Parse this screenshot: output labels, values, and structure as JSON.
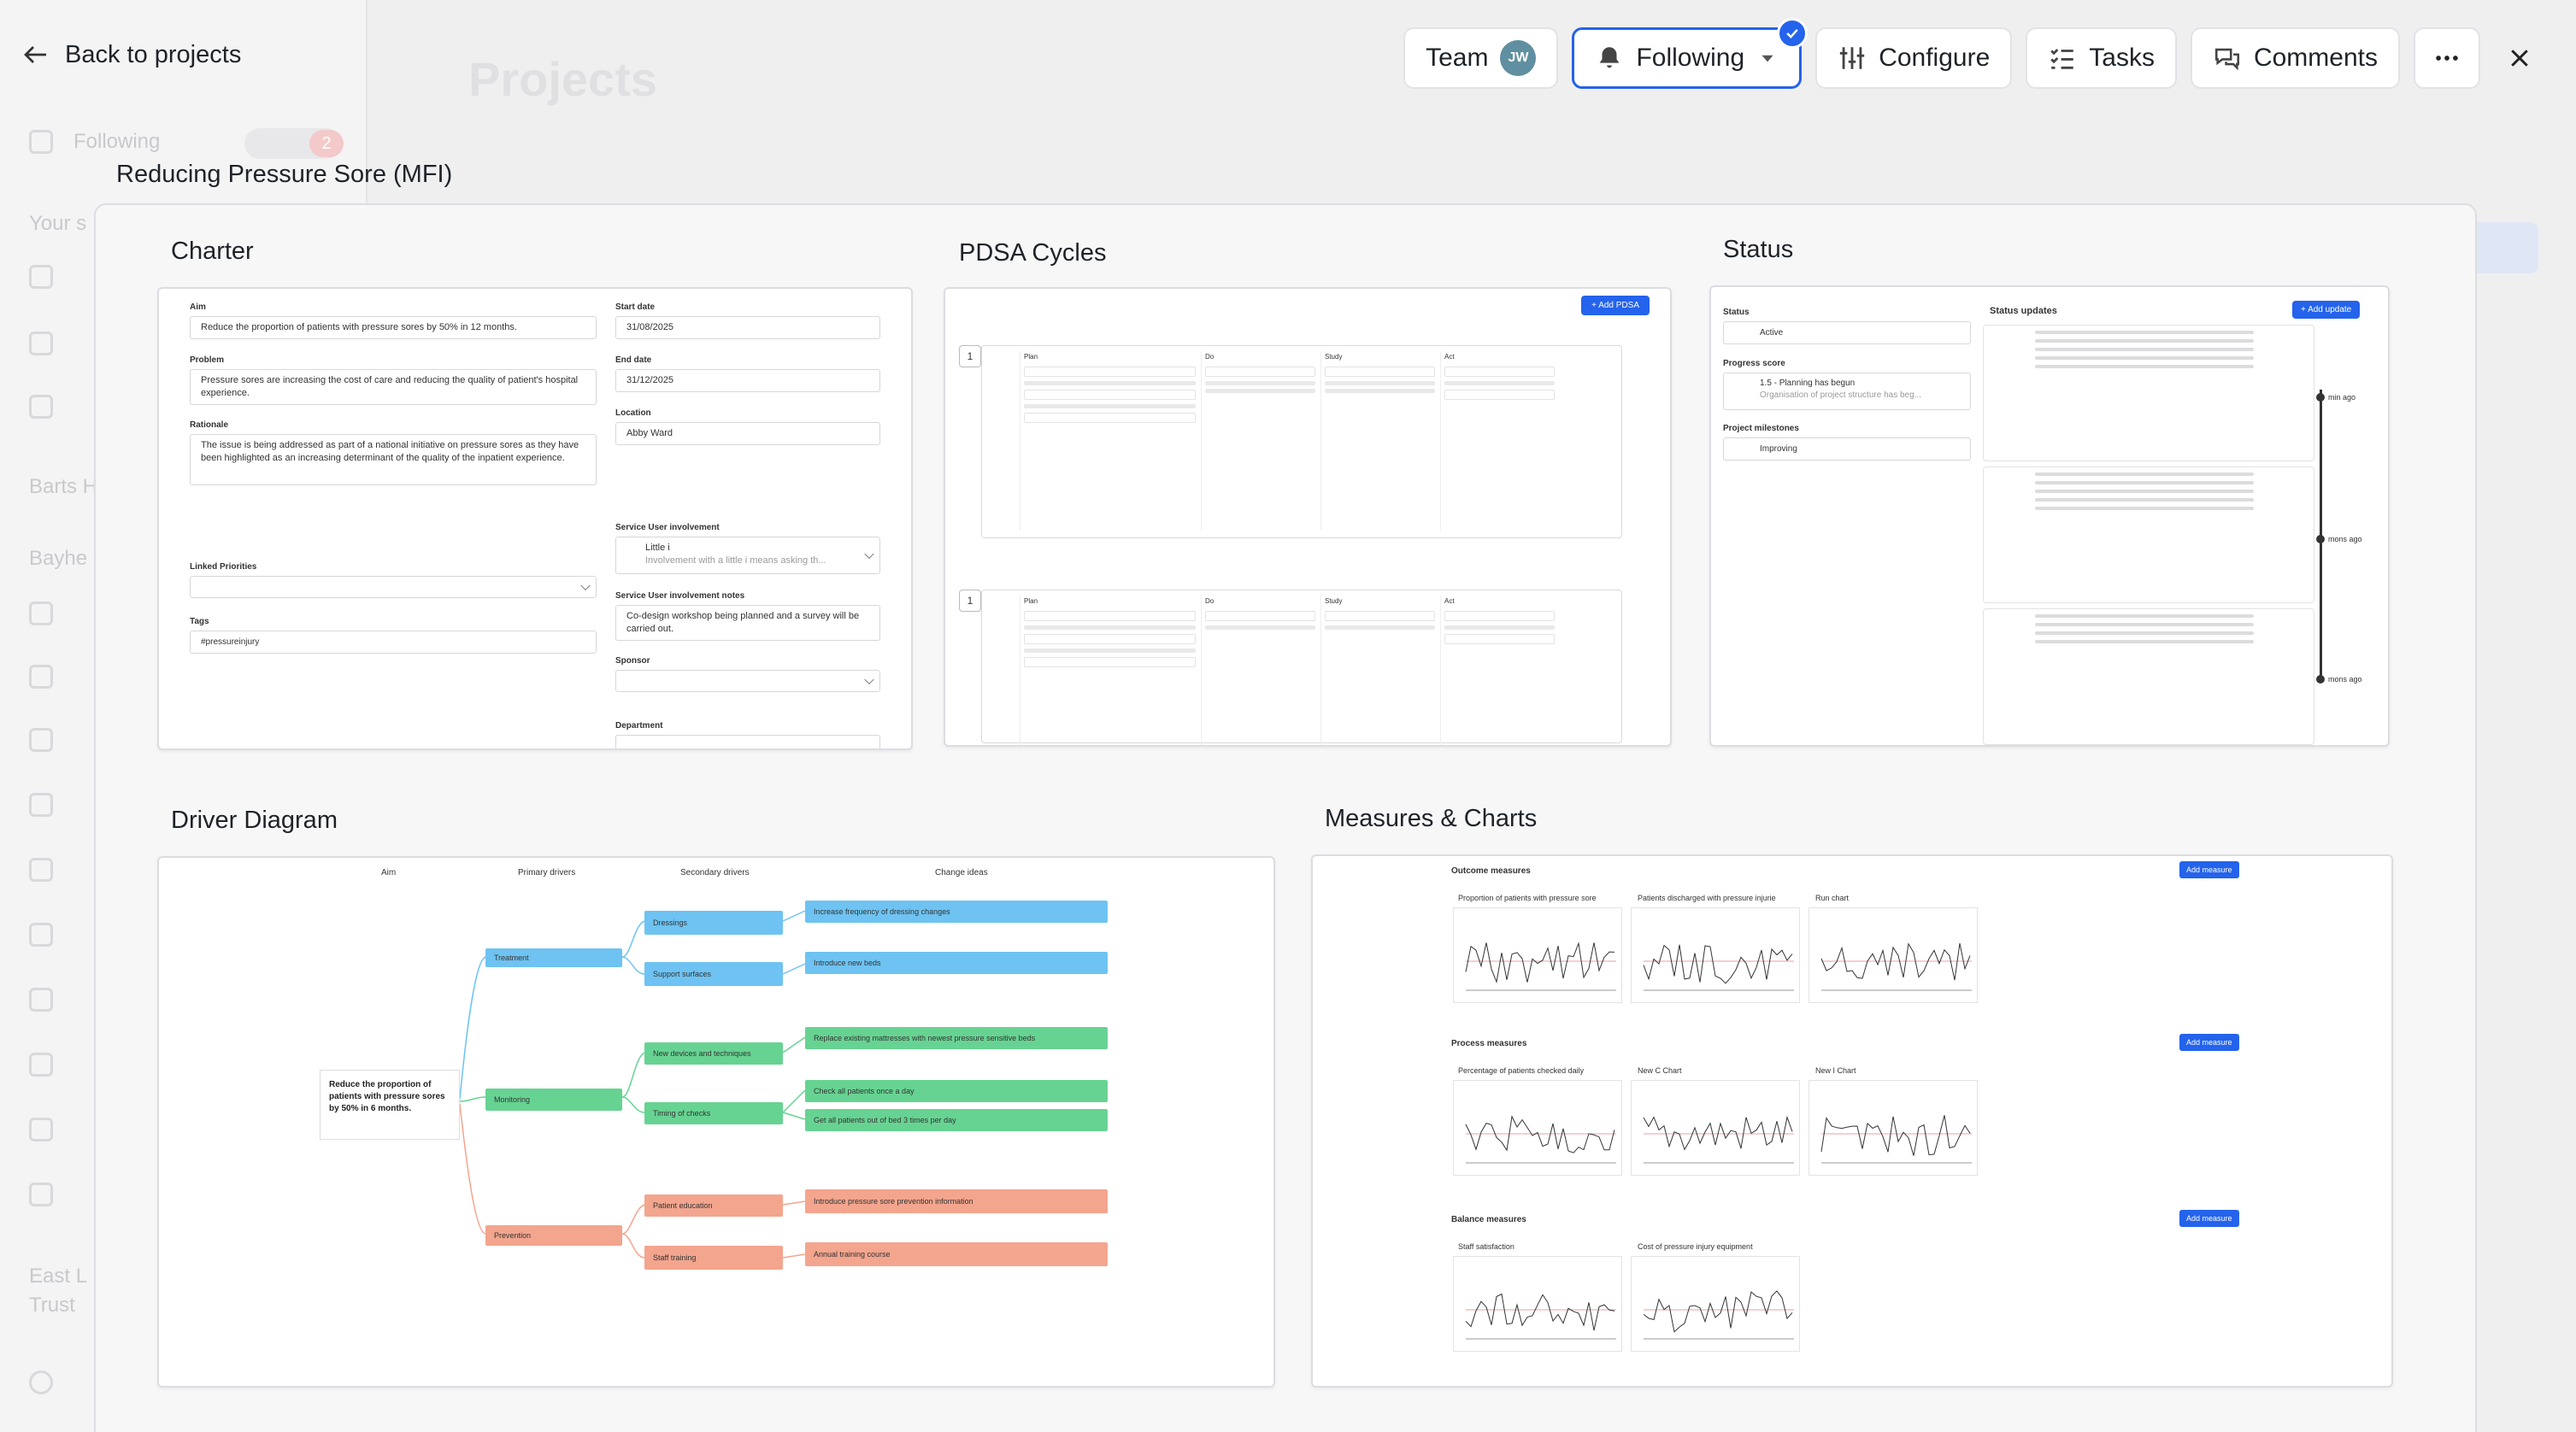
{
  "header": {
    "back_label": "Back to projects",
    "team_label": "Team",
    "team_avatar": "JW",
    "following_label": "Following",
    "configure_label": "Configure",
    "tasks_label": "Tasks",
    "comments_label": "Comments"
  },
  "background": {
    "ghost_following": "Following",
    "ghost_badge": "2",
    "ghost_your": "Your s",
    "ghost_barts": "Barts H",
    "ghost_bayhe": "Bayhe",
    "ghost_east": "East L",
    "ghost_trust": "Trust",
    "ghost_title": "Projects"
  },
  "project": {
    "title": "Reducing Pressure Sore (MFI)"
  },
  "charter": {
    "title": "Charter",
    "aim_label": "Aim",
    "aim_value": "Reduce the proportion of patients with pressure sores by 50% in 12 months.",
    "problem_label": "Problem",
    "problem_value": "Pressure sores are increasing the cost of care and reducing the quality of patient's hospital experience.",
    "rationale_label": "Rationale",
    "rationale_value": "The issue is being addressed as part of a national initiative on pressure sores as they have been highlighted as an increasing determinant of the quality of the inpatient experience.",
    "linked_label": "Linked Priorities",
    "tags_label": "Tags",
    "tags_value": "#pressureinjury",
    "start_label": "Start date",
    "start_value": "31/08/2025",
    "end_label": "End date",
    "end_value": "31/12/2025",
    "location_label": "Location",
    "location_value": "Abby Ward",
    "sui_label": "Service User involvement",
    "sui_value": "Little i",
    "sui_sub": "Involvement with a little i means asking th...",
    "suin_label": "Service User involvement notes",
    "suin_value": "Co-design workshop being planned and a survey will be carried out.",
    "sponsor_label": "Sponsor",
    "department_label": "Department"
  },
  "pdsa": {
    "title": "PDSA Cycles",
    "add_label": "+ Add PDSA",
    "rows": [
      {
        "num": "1",
        "plan": "Plan",
        "do": "Do",
        "study": "Study",
        "act": "Act"
      },
      {
        "num": "1",
        "plan": "Plan",
        "do": "Do",
        "study": "Study",
        "act": "Act"
      }
    ]
  },
  "status": {
    "title": "Status",
    "status_label": "Status",
    "status_value": "Active",
    "progress_label": "Progress score",
    "progress_value": "1.5 - Planning has begun",
    "progress_sub": "Organisation of project structure has beg...",
    "milestones_label": "Project milestones",
    "milestones_value": "Improving",
    "updates_label": "Status updates",
    "add_update_label": "+ Add update",
    "timeline": [
      "min ago",
      "mons ago",
      "mons ago"
    ]
  },
  "driver": {
    "title": "Driver Diagram",
    "headers": [
      "Aim",
      "Primary drivers",
      "Secondary drivers",
      "Change ideas"
    ],
    "aim": "Reduce the proportion of patients with pressure sores by 50% in 6 months.",
    "primary": [
      "Treatment",
      "Monitoring",
      "Prevention"
    ],
    "secondary": [
      "Dressings",
      "Support surfaces",
      "New devices and techniques",
      "Timing of checks",
      "Patient education",
      "Staff training"
    ],
    "change": [
      "Increase frequency of dressing changes",
      "Introduce new beds",
      "Replace existing mattresses with newest pressure sensitive beds",
      "Check all patients once a day",
      "Get all patients out of bed 3 times per day",
      "Introduce pressure sore prevention information",
      "Annual training course"
    ],
    "colors": {
      "blue": "#6ec3f2",
      "green": "#67d392",
      "red": "#f3a58e"
    }
  },
  "measures": {
    "title": "Measures & Charts",
    "add_label": "Add measure",
    "sections": [
      {
        "name": "Outcome measures",
        "charts": [
          "Proportion of patients with pressure sore",
          "Patients discharged with pressure injurie",
          "Run chart"
        ]
      },
      {
        "name": "Process measures",
        "charts": [
          "Percentage of patients checked daily",
          "New C Chart",
          "New I Chart"
        ]
      },
      {
        "name": "Balance measures",
        "charts": [
          "Staff satisfaction",
          "Cost of pressure injury equipment"
        ]
      }
    ]
  },
  "colors": {
    "accent": "#2463eb"
  }
}
